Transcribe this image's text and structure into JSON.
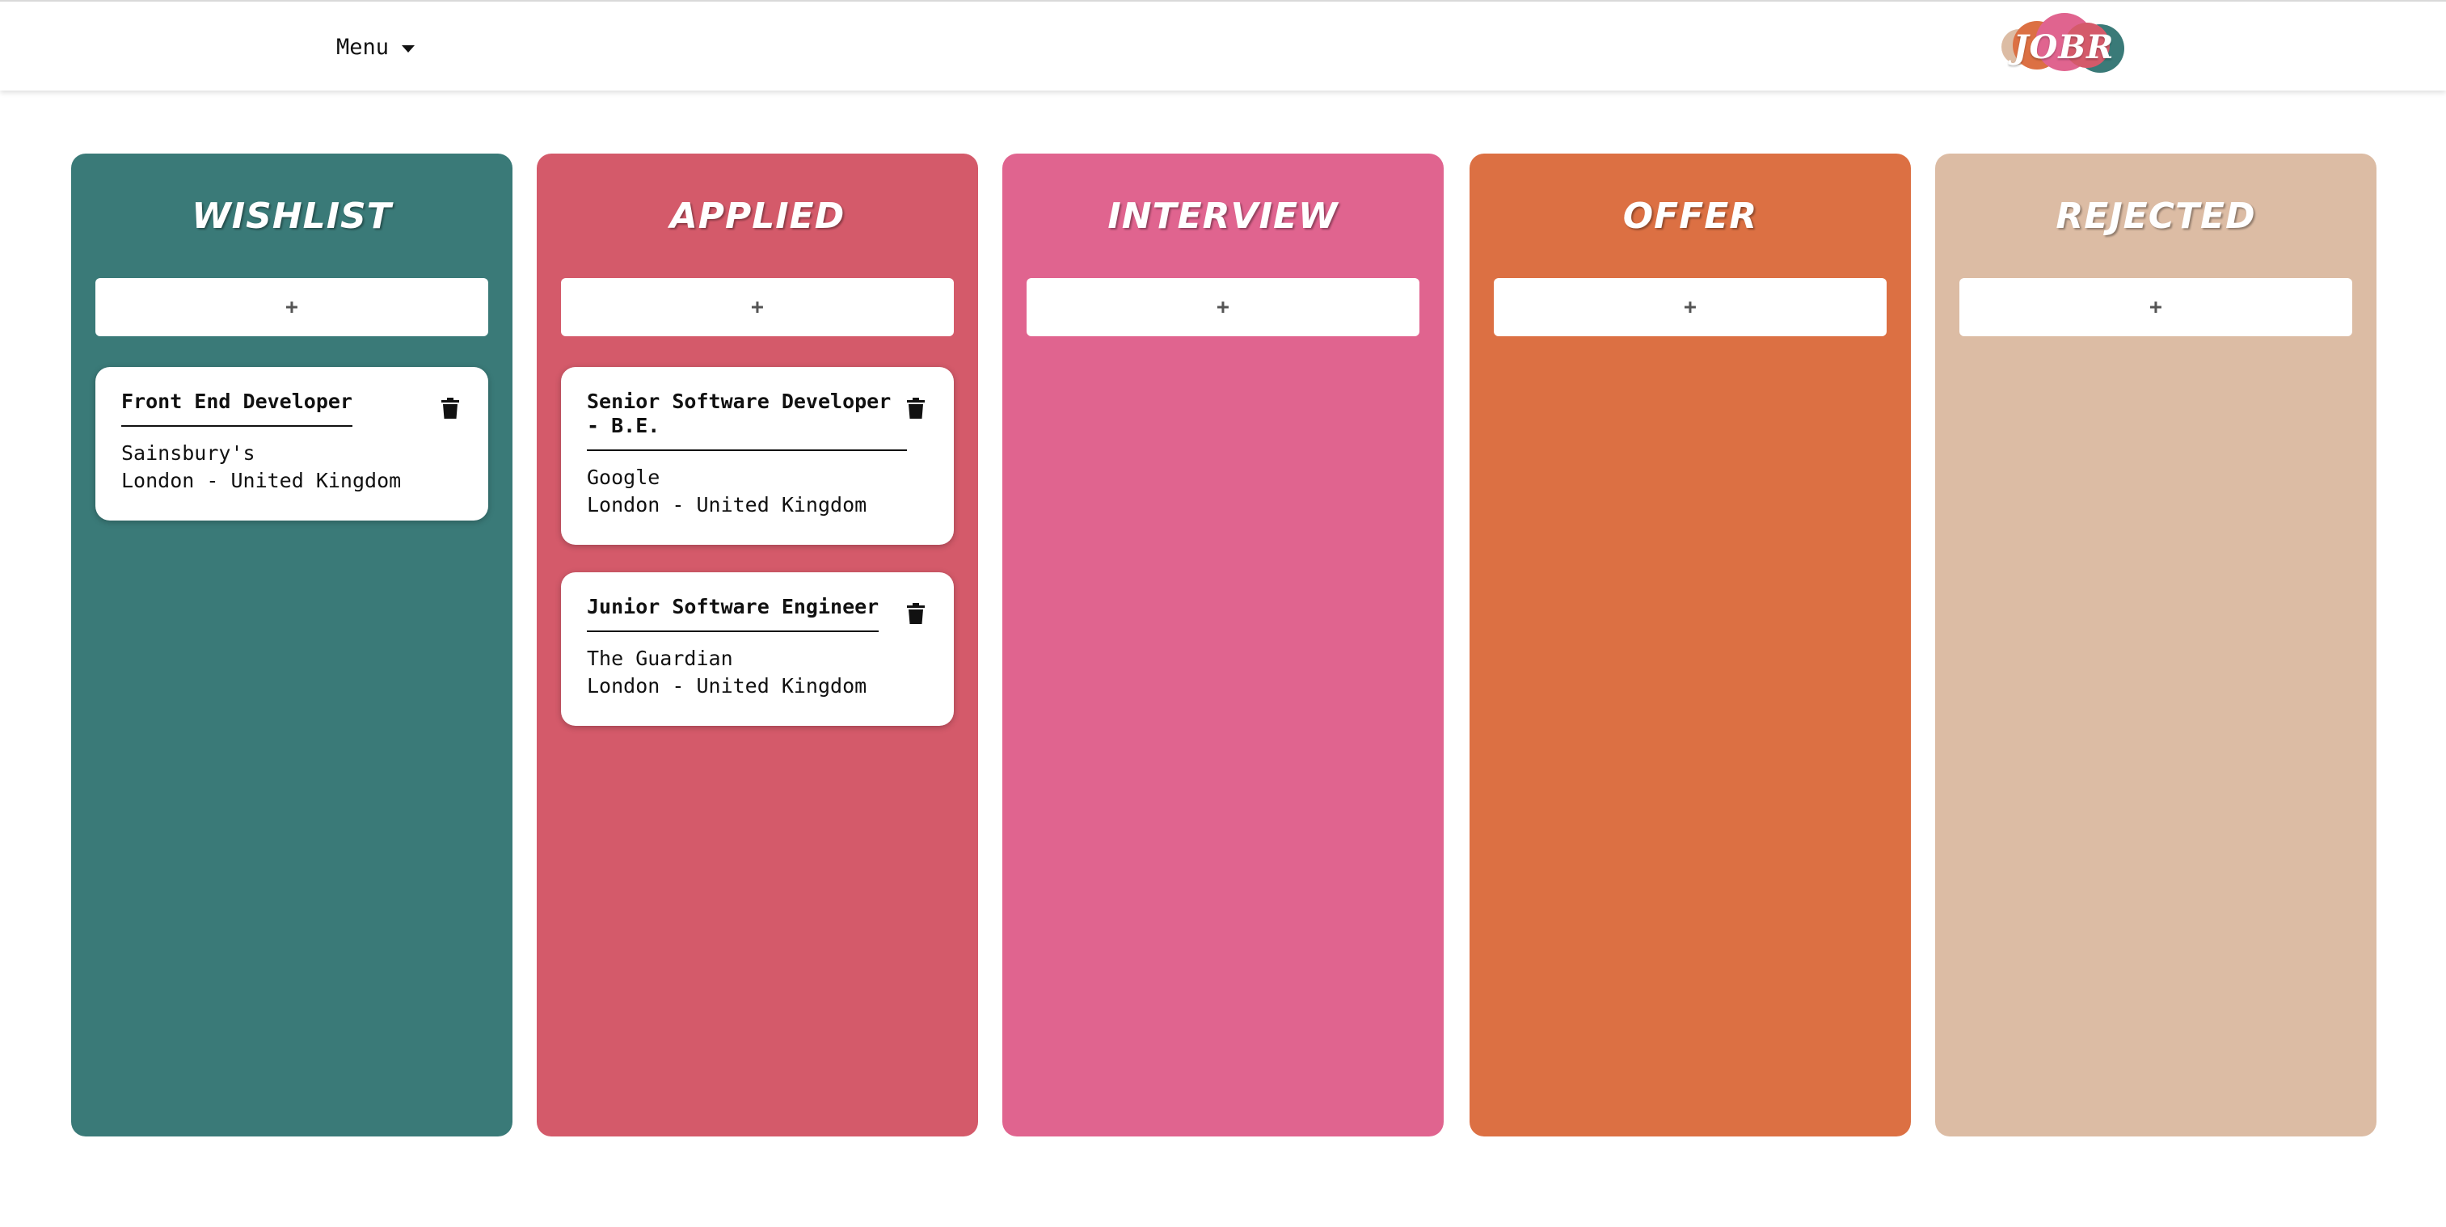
{
  "header": {
    "menu_label": "Menu",
    "menu_icon": "caret-down-icon",
    "logo_text": "JOBR",
    "logo_colors": [
      "#dcbca4",
      "#dc7043",
      "#e0648f",
      "#3a7a78",
      "#d45a6a"
    ]
  },
  "columns": [
    {
      "title": "WISHLIST",
      "color": "#3a7a78",
      "add_label": "+",
      "cards": [
        {
          "title": "Front End Developer",
          "company": "Sainsbury's",
          "location": "London - United Kingdom",
          "delete_icon": "trash-icon"
        }
      ]
    },
    {
      "title": "APPLIED",
      "color": "#d45a6a",
      "add_label": "+",
      "cards": [
        {
          "title": "Senior Software Developer - B.E.",
          "company": "Google",
          "location": "London - United Kingdom",
          "delete_icon": "trash-icon"
        },
        {
          "title": "Junior Software Engineer",
          "company": "The Guardian",
          "location": "London - United Kingdom",
          "delete_icon": "trash-icon"
        }
      ]
    },
    {
      "title": "INTERVIEW",
      "color": "#e0648f",
      "add_label": "+",
      "cards": []
    },
    {
      "title": "OFFER",
      "color": "#dc7043",
      "add_label": "+",
      "cards": []
    },
    {
      "title": "REJECTED",
      "color": "#dcbca4",
      "add_label": "+",
      "cards": []
    }
  ]
}
